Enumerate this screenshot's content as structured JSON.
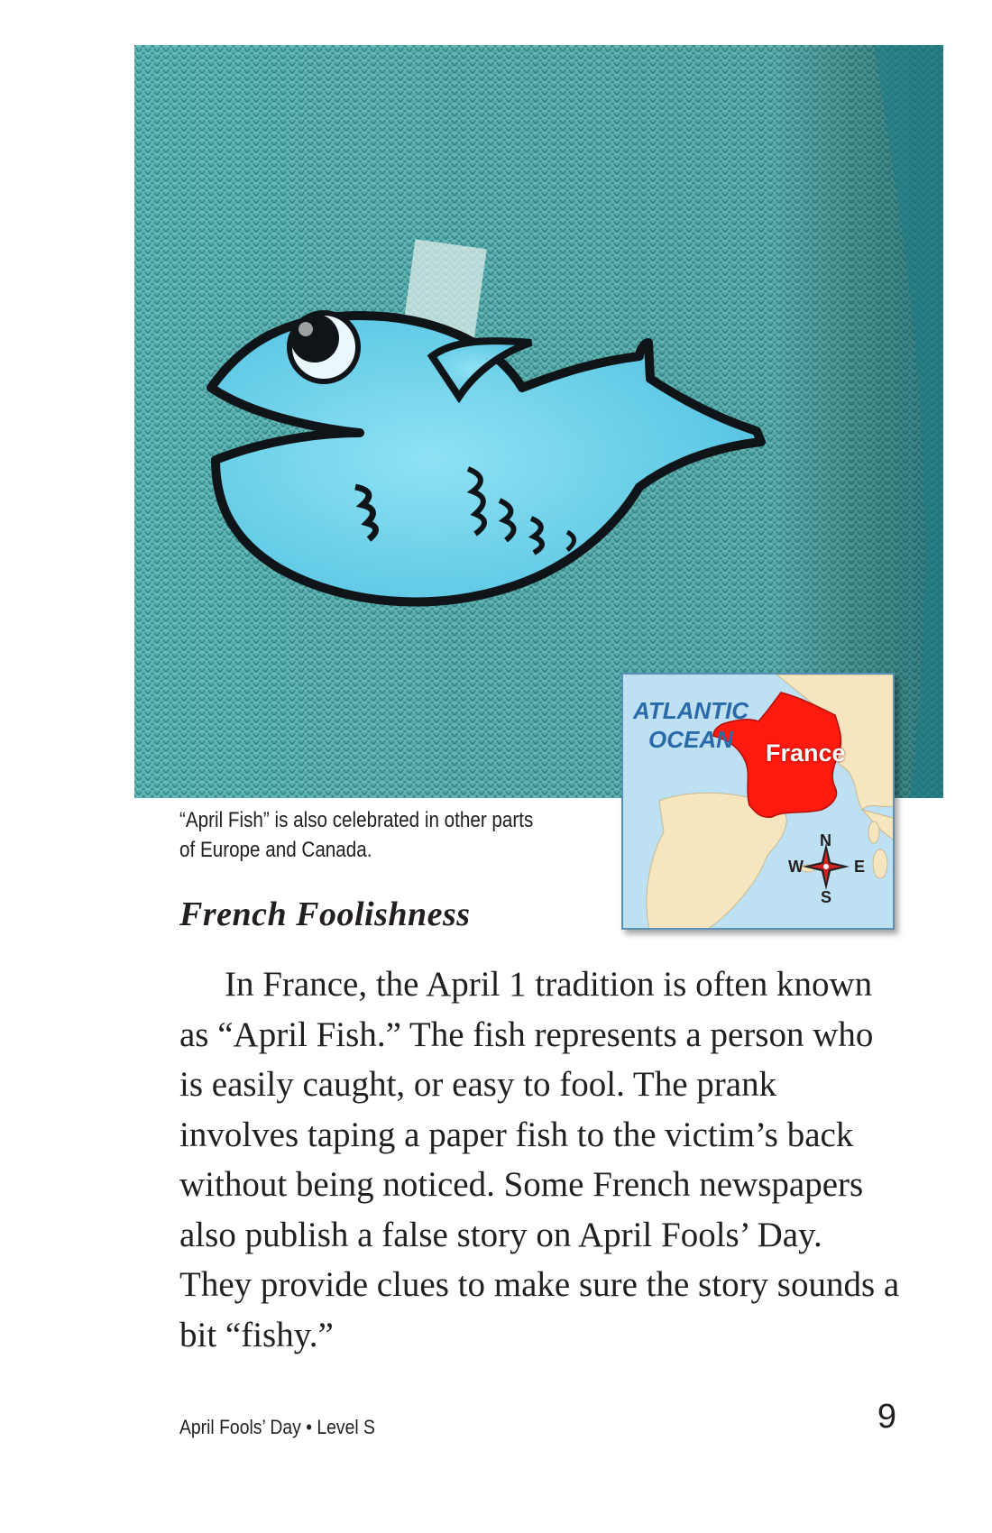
{
  "photo": {
    "subject": "paper fish taped to a knit sweater",
    "colors": {
      "sweater": "#4aa6a6",
      "fish": "#6fd3ec",
      "outline": "#101418"
    }
  },
  "caption": "“April Fish” is also celebrated in other parts of Europe and Canada.",
  "map": {
    "ocean_label_line1": "ATLANTIC",
    "ocean_label_line2": "OCEAN",
    "country_label": "France",
    "compass": {
      "n": "N",
      "s": "S",
      "e": "E",
      "w": "W"
    },
    "colors": {
      "sea": "#bde0f3",
      "land": "#f6e6bf",
      "highlight": "#ff1a10",
      "ocean_text": "#2a6aa8"
    }
  },
  "section_heading": "French Foolishness",
  "body_paragraph": "In France, the April 1 tradition is often known as “April Fish.” The fish represents a person who is easily caught, or easy to fool. The prank involves taping a paper fish to the victim’s back without being noticed. Some French newspapers also publish a false story on April Fools’ Day. They provide clues to make sure the story sounds a bit “fishy.”",
  "footer": {
    "book_title": "April Fools’ Day • Level S",
    "page_number": "9"
  }
}
